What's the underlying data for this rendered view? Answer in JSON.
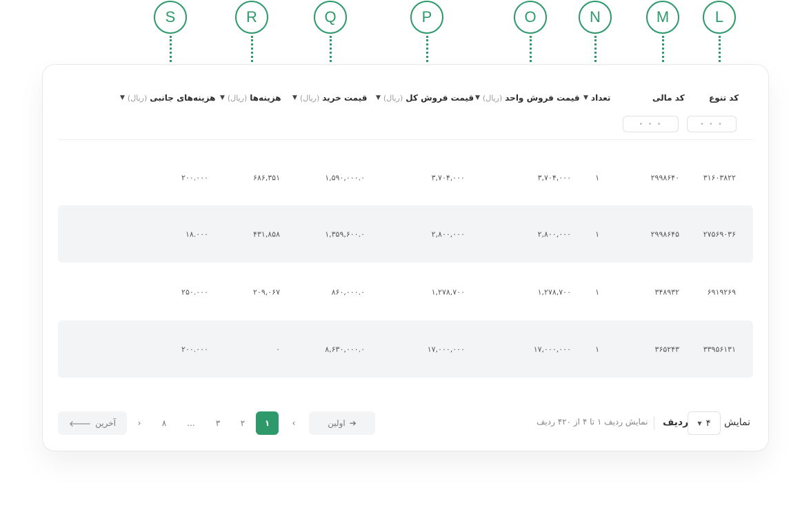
{
  "markers": [
    "S",
    "R",
    "Q",
    "P",
    "O",
    "N",
    "M",
    "L"
  ],
  "columns": {
    "variety_code": "کد تنوع",
    "financial_code": "کد مالی",
    "quantity": "تعداد",
    "unit_price": "قیمت فروش واحد",
    "total_price": "قیمت فروش کل",
    "purchase_price": "قیمت خرید",
    "costs": "هزینه‌ها",
    "side_costs": "هزینه‌های جانبی",
    "unit": "(ریال)"
  },
  "filters": {
    "placeholder": "• • •"
  },
  "rows": [
    {
      "variety_code": "۳۱۶۰۳۸۲۲",
      "financial_code": "۲۹۹۸۶۴۰",
      "quantity": "۱",
      "unit_price": "۳,۷۰۴,۰۰۰",
      "total_price": "۳,۷۰۴,۰۰۰",
      "purchase_price": "۱,۵۹۰,۰۰۰.۰",
      "costs": "۶۸۶,۳۵۱",
      "side_costs": "۲۰۰.۰۰۰"
    },
    {
      "variety_code": "۲۷۵۶۹۰۳۶",
      "financial_code": "۲۹۹۸۶۴۵",
      "quantity": "۱",
      "unit_price": "۲,۸۰۰,۰۰۰",
      "total_price": "۲,۸۰۰,۰۰۰",
      "purchase_price": "۱,۳۵۹,۶۰۰.۰",
      "costs": "۴۳۱,۸۵۸",
      "side_costs": "۱۸.۰۰۰"
    },
    {
      "variety_code": "۶۹۱۹۲۶۹",
      "financial_code": "۳۴۸۹۳۲",
      "quantity": "۱",
      "unit_price": "۱,۲۷۸,۷۰۰",
      "total_price": "۱,۲۷۸,۷۰۰",
      "purchase_price": "۸۶۰,۰۰۰.۰",
      "costs": "۲۰۹,۰۶۷",
      "side_costs": "۲۵۰.۰۰۰"
    },
    {
      "variety_code": "۳۳۹۵۶۱۳۱",
      "financial_code": "۳۶۵۲۴۳",
      "quantity": "۱",
      "unit_price": "۱۷,۰۰۰,۰۰۰",
      "total_price": "۱۷,۰۰۰,۰۰۰",
      "purchase_price": "۸,۶۳۰,۰۰۰.۰",
      "costs": "۰",
      "side_costs": "۲۰۰.۰۰۰"
    }
  ],
  "footer": {
    "show_label": "نمایش",
    "rows_value": "۴",
    "rows_label": "ردیف",
    "summary": "نمایش ردیف ۱ تا ۴ از ۴۲۰ ردیف"
  },
  "pagination": {
    "first": "اولین",
    "last": "آخرین",
    "pages": [
      "۱",
      "۲",
      "۳",
      "...",
      "۸"
    ],
    "current": "۱"
  },
  "colors": {
    "accent": "#2e9a6c",
    "row_shade": "#f3f4f5"
  }
}
